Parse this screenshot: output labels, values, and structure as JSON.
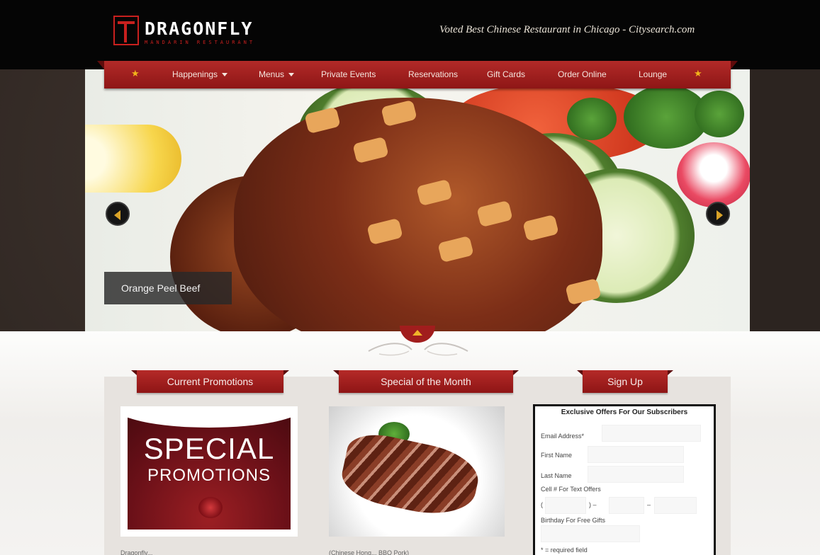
{
  "header": {
    "logo_text": "DRAGONFLY",
    "logo_subtext": "MANDARIN RESTAURANT",
    "tagline": "Voted Best Chinese Restaurant in Chicago - Citysearch.com"
  },
  "nav": {
    "items": [
      {
        "label": "Happenings",
        "dropdown": true
      },
      {
        "label": "Menus",
        "dropdown": true
      },
      {
        "label": "Private Events",
        "dropdown": false
      },
      {
        "label": "Reservations",
        "dropdown": false
      },
      {
        "label": "Gift Cards",
        "dropdown": false
      },
      {
        "label": "Order Online",
        "dropdown": false
      },
      {
        "label": "Lounge",
        "dropdown": false
      }
    ],
    "star": "★"
  },
  "slider": {
    "caption": "Orange Peel Beef"
  },
  "sections": {
    "promotions": {
      "heading": "Current Promotions",
      "image_title": "SPECIAL",
      "image_subtitle": "PROMOTIONS",
      "teaser": "Dragonfly..."
    },
    "special": {
      "heading": "Special of the Month",
      "teaser": "(Chinese Hong... BBQ Pork)"
    },
    "signup": {
      "heading": "Sign Up",
      "form_title": "Exclusive Offers For Our Subscribers",
      "email_label": "Email Address*",
      "first_name_label": "First Name",
      "last_name_label": "Last Name",
      "cell_label": "Cell # For Text Offers",
      "phone_open_paren": "(",
      "phone_close_paren": ") –",
      "phone_dash": "–",
      "birthday_label": "Birthday For Free Gifts",
      "required_note": "* = required field"
    }
  },
  "colors": {
    "brand_red": "#a11d1d",
    "accent_gold": "#f2b51b",
    "header_bg": "#050505"
  }
}
